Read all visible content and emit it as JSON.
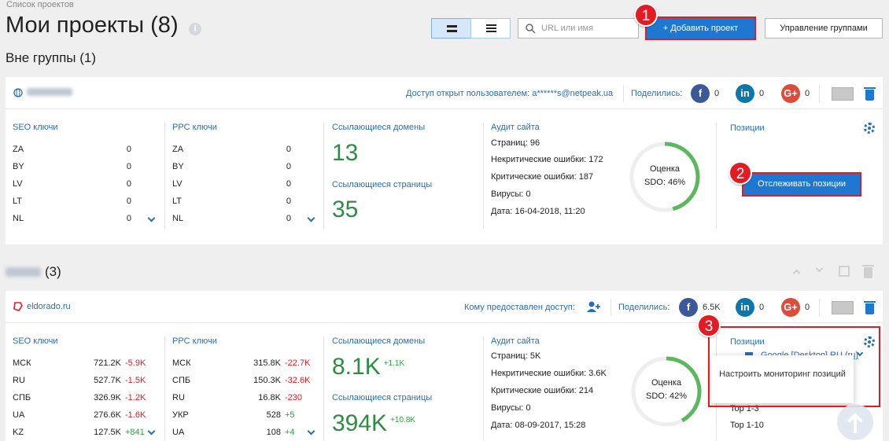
{
  "breadcrumb": "Список проектов",
  "page_title": "Мои проекты (8)",
  "search": {
    "placeholder": "URL или имя"
  },
  "buttons": {
    "add_project": "+ Добавить проект",
    "manage_groups": "Управление группами",
    "track_positions": "Отслеживать позиции"
  },
  "annotations": [
    "1",
    "2",
    "3"
  ],
  "groups": [
    {
      "title": "Вне группы (1)"
    },
    {
      "title_suffix": "(3)"
    }
  ],
  "project1": {
    "access_text": "Доступ открыт пользователем: a******s@netpeak.ua",
    "shared_label": "Поделились:",
    "shares": {
      "facebook": "0",
      "linkedin": "0",
      "gplus": "0"
    },
    "seo_title": "SEO ключи",
    "seo": [
      {
        "c": "ZA",
        "v": "0"
      },
      {
        "c": "BY",
        "v": "0"
      },
      {
        "c": "LV",
        "v": "0"
      },
      {
        "c": "LT",
        "v": "0"
      },
      {
        "c": "NL",
        "v": "0"
      }
    ],
    "ppc_title": "PPC ключи",
    "ppc": [
      {
        "c": "ZA",
        "v": "0"
      },
      {
        "c": "BY",
        "v": "0"
      },
      {
        "c": "LV",
        "v": "0"
      },
      {
        "c": "LT",
        "v": "0"
      },
      {
        "c": "NL",
        "v": "0"
      }
    ],
    "ref_domains_title": "Ссылающиеся домены",
    "ref_domains": "13",
    "ref_pages_title": "Ссылающиеся страницы",
    "ref_pages": "35",
    "audit_title": "Аудит сайта",
    "audit": [
      "Страниц: 96",
      "Некритические ошибки: 172",
      "Критические ошибки: 187",
      "Вирусы: 0",
      "Дата: 16-04-2018, 11:20"
    ],
    "gauge_label": "Оценка",
    "gauge_value": "SDO: 46%",
    "gauge_pct": 46,
    "positions_title": "Позиции"
  },
  "project2": {
    "domain": "eldorado.ru",
    "access_text": "Кому предоставлен доступ:",
    "shared_label": "Поделились:",
    "shares": {
      "facebook": "6.5K",
      "linkedin": "0",
      "gplus": "0"
    },
    "seo_title": "SEO ключи",
    "seo": [
      {
        "c": "МСК",
        "v": "721.2K",
        "d": "-5.9K",
        "s": "neg"
      },
      {
        "c": "RU",
        "v": "527.7K",
        "d": "-1.5K",
        "s": "neg"
      },
      {
        "c": "СПБ",
        "v": "326.9K",
        "d": "-1.2K",
        "s": "neg"
      },
      {
        "c": "UA",
        "v": "276.6K",
        "d": "-1.6K",
        "s": "neg"
      },
      {
        "c": "KZ",
        "v": "127.5K",
        "d": "+841",
        "s": "pos"
      }
    ],
    "ppc_title": "PPC ключи",
    "ppc": [
      {
        "c": "МСК",
        "v": "315.8K",
        "d": "-22.7K",
        "s": "neg"
      },
      {
        "c": "СПБ",
        "v": "150.3K",
        "d": "-32.6K",
        "s": "neg"
      },
      {
        "c": "RU",
        "v": "16.8K",
        "d": "-230",
        "s": "neg"
      },
      {
        "c": "УКР",
        "v": "528",
        "d": "+5",
        "s": "pos"
      },
      {
        "c": "UA",
        "v": "108",
        "d": "+4",
        "s": "pos"
      }
    ],
    "ref_domains_title": "Ссылающиеся домены",
    "ref_domains": "8.1K",
    "ref_domains_delta": "+1.1K",
    "ref_pages_title": "Ссылающиеся страницы",
    "ref_pages": "394K",
    "ref_pages_delta": "+10.8K",
    "audit_title": "Аудит сайта",
    "audit": [
      "Страниц: 5K",
      "Некритические ошибки: 3.6K",
      "Критические ошибки: 214",
      "Вирусы: 0",
      "Дата: 08-09-2017, 15:28"
    ],
    "gauge_label": "Оценка",
    "gauge_value": "SDO: 42%",
    "gauge_pct": 42,
    "positions_title": "Позиции",
    "positions_engine": "Google [Desktop] RU (ru)",
    "positions_tooltip": "Настроить мониторинг позиций",
    "positions_rows": [
      "Top 1-3",
      "Top 1-10"
    ]
  },
  "colors": {
    "accent": "#1e78d2",
    "green": "#2f9e41",
    "red": "#e31b23",
    "link": "#2a6db5"
  },
  "icons": [
    "info-icon",
    "grid-view-icon",
    "list-view-icon",
    "search-icon",
    "globe-icon",
    "facebook-icon",
    "linkedin-icon",
    "google-plus-icon",
    "mail-icon",
    "trash-icon",
    "chevron-down-icon",
    "gear-icon",
    "add-user-icon",
    "eldorado-logo-icon",
    "arrow-up-icon"
  ]
}
